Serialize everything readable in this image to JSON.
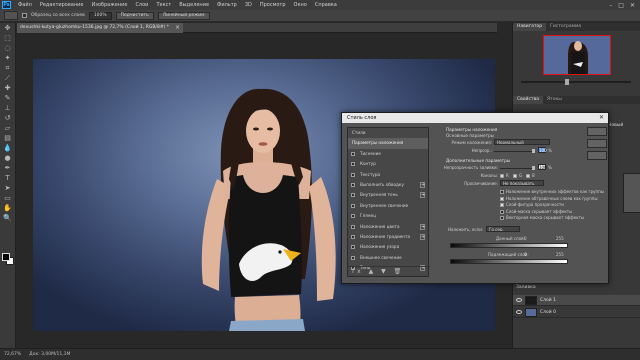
{
  "menubar": {
    "logo": "Ps",
    "items": [
      "Файл",
      "Редактирование",
      "Изображение",
      "Слои",
      "Текст",
      "Выделение",
      "Фильтр",
      "3D",
      "Просмотр",
      "Окно",
      "Справка"
    ]
  },
  "options": {
    "sample_all": "Образец со всех слоев",
    "percent": "100%",
    "button1": "Подчистить",
    "button2": "Линейный режим"
  },
  "document": {
    "tab_title": "devushki-kutya-gluzhomku-1536.jpg @ 72,7% (Слой 1, RGB/8#) *"
  },
  "status": {
    "zoom": "72,67%",
    "doc": "Док: 3,00М/11,1М"
  },
  "right_panels": {
    "top_tabs": [
      "Навигатор",
      "Гистограмма"
    ],
    "mid_tabs": [
      "Свойства",
      "Ятокы"
    ],
    "layers": [
      {
        "name": "Слой 1"
      },
      {
        "name": "Слой 0"
      }
    ],
    "bottom_label": "Заливка",
    "side_label": "Новый"
  },
  "dialog": {
    "title": "Стиль слоя",
    "styles_header": "Стили",
    "styles": [
      {
        "label": "Параметры наложения",
        "selected": true,
        "check": false,
        "plus": false
      },
      {
        "label": "Тиснение",
        "check": true,
        "plus": false
      },
      {
        "label": "Контур",
        "check": true,
        "plus": false
      },
      {
        "label": "Текстура",
        "check": true,
        "plus": false
      },
      {
        "label": "Выполнить обводку",
        "check": true,
        "plus": true
      },
      {
        "label": "Внутренняя тень",
        "check": true,
        "plus": true
      },
      {
        "label": "Внутреннее свечение",
        "check": true,
        "plus": false
      },
      {
        "label": "Глянец",
        "check": true,
        "plus": false
      },
      {
        "label": "Наложение цвета",
        "check": true,
        "plus": true
      },
      {
        "label": "Наложение градиента",
        "check": true,
        "plus": true
      },
      {
        "label": "Наложение узора",
        "check": true,
        "plus": false
      },
      {
        "label": "Внешнее свечение",
        "check": true,
        "plus": false
      },
      {
        "label": "Тень",
        "check": true,
        "plus": true
      }
    ],
    "footer": "fx ▲ ▼ 🗑",
    "blend": {
      "group": "Параметры наложения",
      "subgroup": "Основные параметры",
      "mode_label": "Режим наложения:",
      "mode_value": "Нормальный",
      "opacity_label": "Непрозр.:",
      "opacity_value": "100",
      "percent": "%"
    },
    "advanced": {
      "group": "Дополнительные параметры",
      "fill_label": "Непрозрачность заливки:",
      "fill_value": "100",
      "channels_label": "Каналы:",
      "channels": [
        "R",
        "G",
        "B"
      ],
      "knockout_label": "Просвечивание:",
      "knockout_value": "Не показывать",
      "options": [
        {
          "label": "Наложение внутренних эффектов как группы",
          "on": false
        },
        {
          "label": "Наложение обтравочных слоев как группы",
          "on": true
        },
        {
          "label": "Слой-фигура прозрачности",
          "on": true
        },
        {
          "label": "Слой-маска скрывает эффекты",
          "on": false
        },
        {
          "label": "Векторная маска скрывает эффекты",
          "on": false
        }
      ]
    },
    "blend_if": {
      "label": "Наложить, если:",
      "value": "Го сер.",
      "this_layer": "Данный слой:",
      "under_layer": "Подлежащий слой:",
      "min": "0",
      "max": "255"
    }
  }
}
